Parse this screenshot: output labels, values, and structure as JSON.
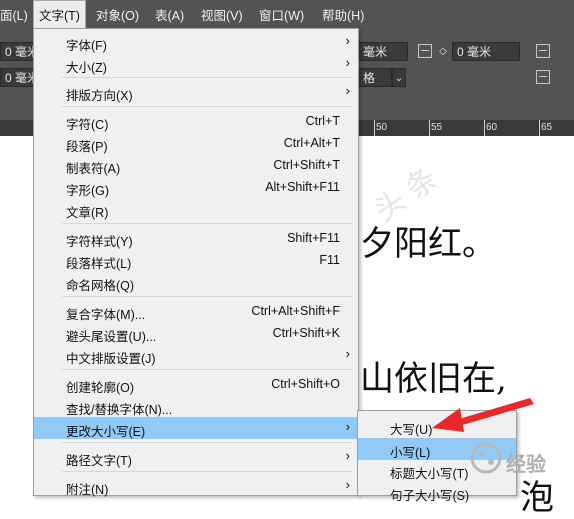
{
  "menubar": {
    "items": [
      "面(L)",
      "文字(T)",
      "对象(O)",
      "表(A)",
      "视图(V)",
      "窗口(W)",
      "帮助(H)"
    ]
  },
  "control": {
    "field1_value": "0 毫米",
    "field2_value": "0 毫米",
    "field3_value": "毫米",
    "field4_value": "0 毫米",
    "field5_value": "格"
  },
  "ruler": {
    "labels": [
      "50",
      "55",
      "60",
      "65",
      "70",
      "75",
      "80"
    ]
  },
  "page": {
    "line1": "夕阳红。",
    "line2": "山依旧在,",
    "line3": "泡"
  },
  "menu": {
    "items": [
      {
        "label": "字体(F)",
        "shortcut": "",
        "submenu": true
      },
      {
        "label": "大小(Z)",
        "shortcut": "",
        "submenu": true
      },
      {
        "label": "排版方向(X)",
        "shortcut": "",
        "submenu": true
      },
      {
        "label": "字符(C)",
        "shortcut": "Ctrl+T",
        "submenu": false
      },
      {
        "label": "段落(P)",
        "shortcut": "Ctrl+Alt+T",
        "submenu": false
      },
      {
        "label": "制表符(A)",
        "shortcut": "Ctrl+Shift+T",
        "submenu": false
      },
      {
        "label": "字形(G)",
        "shortcut": "Alt+Shift+F11",
        "submenu": false
      },
      {
        "label": "文章(R)",
        "shortcut": "",
        "submenu": false
      },
      {
        "label": "字符样式(Y)",
        "shortcut": "Shift+F11",
        "submenu": false
      },
      {
        "label": "段落样式(L)",
        "shortcut": "F11",
        "submenu": false
      },
      {
        "label": "命名网格(Q)",
        "shortcut": "",
        "submenu": false
      },
      {
        "label": "复合字体(M)...",
        "shortcut": "Ctrl+Alt+Shift+F",
        "submenu": false
      },
      {
        "label": "避头尾设置(U)...",
        "shortcut": "Ctrl+Shift+K",
        "submenu": false
      },
      {
        "label": "中文排版设置(J)",
        "shortcut": "",
        "submenu": true
      },
      {
        "label": "创建轮廓(O)",
        "shortcut": "Ctrl+Shift+O",
        "submenu": false
      },
      {
        "label": "查找/替换字体(N)...",
        "shortcut": "",
        "submenu": false
      },
      {
        "label": "更改大小写(E)",
        "shortcut": "",
        "submenu": true
      },
      {
        "label": "路径文字(T)",
        "shortcut": "",
        "submenu": true
      },
      {
        "label": "附注(N)",
        "shortcut": "",
        "submenu": true
      }
    ]
  },
  "submenu": {
    "items": [
      "大写(U)",
      "小写(L)",
      "标题大小写(T)",
      "句子大小写(S)"
    ]
  },
  "logo": {
    "text": "经验"
  },
  "colors": {
    "highlight": "#91c9f7",
    "menubar": "#535353",
    "arrow": "#e8292b"
  }
}
